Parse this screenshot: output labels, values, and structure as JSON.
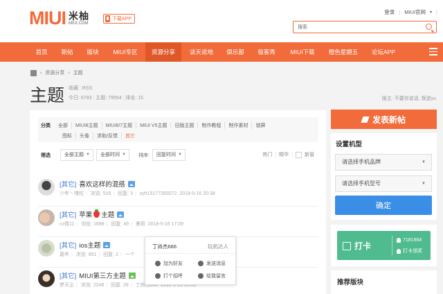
{
  "header": {
    "logo_text": "MIUI",
    "logo_cn": "米柚",
    "logo_domain": "MIUI.COM",
    "download_app": "下载APP",
    "login": "登录",
    "official_site": "MIUI官网",
    "more": "▾",
    "search_placeholder": "搜索"
  },
  "nav": [
    {
      "label": "首页"
    },
    {
      "label": "新帖"
    },
    {
      "label": "版块"
    },
    {
      "label": "MIUI专区"
    },
    {
      "label": "资源分享",
      "active": true
    },
    {
      "label": "谈天说地"
    },
    {
      "label": "俱乐部"
    },
    {
      "label": "极客秀"
    },
    {
      "label": "MIUI下载"
    },
    {
      "label": "橙色星期五"
    },
    {
      "label": "论坛APP"
    }
  ],
  "breadcrumb": {
    "items": [
      "资源分享",
      "主题"
    ],
    "separator": "›"
  },
  "page": {
    "title": "主题",
    "favorite": "收藏",
    "rss": "RSS",
    "today_label": "今日:",
    "today": "6783",
    "topics_label": "主题:",
    "topics": "79554",
    "rank_label": "排名:",
    "rank": "15",
    "moderator_label": "版主:",
    "moderators": [
      "不要你说话",
      "叛逆yu"
    ]
  },
  "filters": {
    "category_label": "分类",
    "categories_row1": [
      "全部",
      "MIUI8主题",
      "MIUI6/7主题",
      "MIUI V5主题",
      "旧版主题",
      "制作教程",
      "制作素材",
      "锁屏"
    ],
    "categories_row2": [
      "图标",
      "头像",
      "求助/反馈",
      "其它"
    ],
    "active_category": "其它",
    "filter_label": "筛选",
    "topic_select": "全部主题",
    "time_select": "全部时间",
    "sort_label": "排序:",
    "sort_select": "回复时间",
    "hot": "热门",
    "digest": "精华",
    "new_window": "新窗"
  },
  "threads": [
    {
      "tag": "[其它]",
      "title": "喜欢这样的混搭",
      "author": "少年丶嘿吃",
      "views_label": "浏览:",
      "views": "516",
      "replies_label": "回复:",
      "replies": "3",
      "last": "zyh15177393072",
      "date": "2018-5-16 20:38"
    },
    {
      "tag": "[其它]",
      "title_a": "苹果",
      "title_b": "主题",
      "author": "cz情11",
      "views_label": "浏览:",
      "views": "1698",
      "replies_label": "回复:",
      "replies": "49",
      "last": "熏荷",
      "date": "2018-5-16 17:09"
    },
    {
      "tag": "[其它]",
      "title": "ios主题",
      "author": "嘉年",
      "views_label": "浏览:",
      "views": "651",
      "replies_label": "回复:",
      "replies": "2",
      "last": "一个"
    },
    {
      "tag": "[其它]",
      "title": "MIUI第三方主题",
      "author": "梦天尘",
      "views_label": "浏览:",
      "views": "2248",
      "replies_label": "回复:",
      "replies": "28",
      "last": "丁尚杰666",
      "date": "2018-5-16 08:03"
    }
  ],
  "popup": {
    "name": "丁尚杰666",
    "level": "玩机达人",
    "add_friend": "加为好友",
    "send_msg": "发送消息",
    "greet": "打个招呼",
    "leave_msg": "给我留言"
  },
  "sidebar": {
    "new_post": "发表新帖",
    "model_title": "设置机型",
    "brand_select": "请选择手机品牌",
    "model_select": "请选择手机型号",
    "confirm": "确定",
    "checkin": "打卡",
    "checkin_count": "7181904",
    "checkin_rank": "打卡领奖",
    "recommend_title": "推荐版块"
  },
  "colors": {
    "brand": "#f26b3a",
    "link": "#3a7bd5",
    "confirm": "#3a8ee6",
    "checkin": "#4fbb8f"
  }
}
